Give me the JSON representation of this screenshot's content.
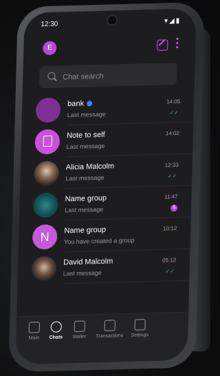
{
  "status": {
    "time": "12:30",
    "icons": "▾◢▮"
  },
  "header": {
    "avatar_initial": "E"
  },
  "search": {
    "placeholder": "Chat search"
  },
  "chats": [
    {
      "name": "bank",
      "verified": true,
      "subtitle": "Last message",
      "time": "14:05",
      "meta": "✓✓"
    },
    {
      "name": "Note to self",
      "subtitle": "Last message",
      "time": "14:02",
      "meta": ""
    },
    {
      "name": "Alicia Malcolm",
      "subtitle": "Last message",
      "time": "12:33",
      "meta": "✓✓"
    },
    {
      "name": "Name group",
      "subtitle": "Last message",
      "time": "11:47",
      "badge": "5"
    },
    {
      "name": "Name group",
      "avatar_letter": "N",
      "subtitle": "You have created a group",
      "time": "10:12",
      "meta": ""
    },
    {
      "name": "David Malcolm",
      "subtitle": "Last message",
      "time": "05.12",
      "meta": "✓✓"
    }
  ],
  "tabs": [
    "Main",
    "Chats",
    "Wallet",
    "Transactions",
    "Settings"
  ]
}
